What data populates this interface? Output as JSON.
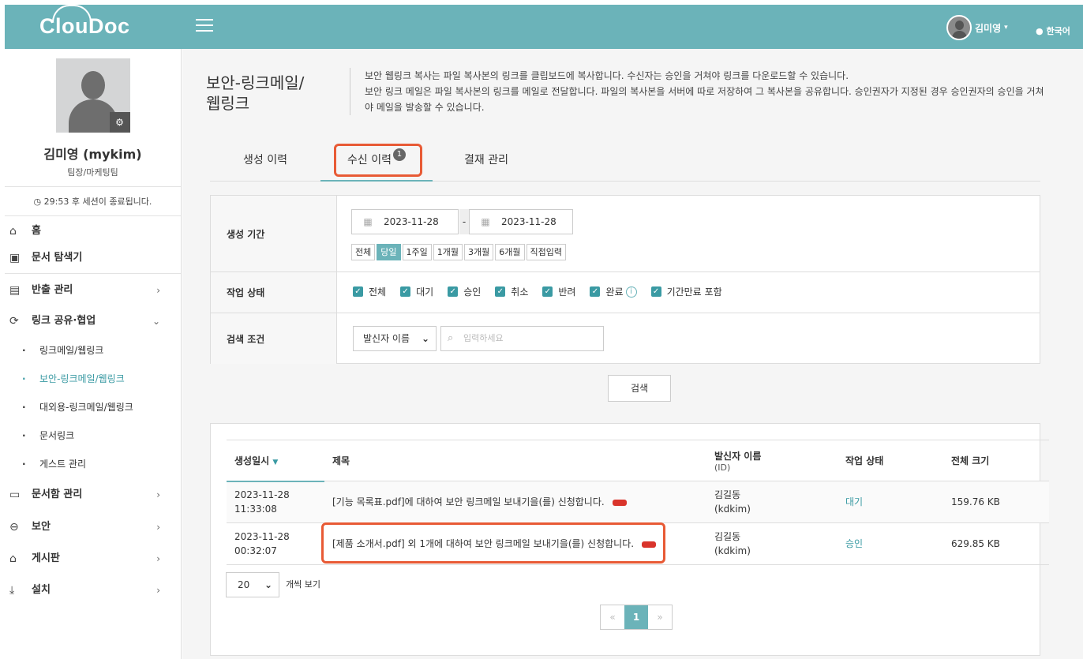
{
  "app": {
    "logo": "ClouDoc"
  },
  "header": {
    "user_name": "김미영",
    "lang": "한국어"
  },
  "profile": {
    "name": "김미영 (mykim)",
    "team": "팀장/마케팅팀",
    "session": "29:53 후 세션이 종료됩니다."
  },
  "sidebar": {
    "items": [
      {
        "label": "홈",
        "icon": "home-icon"
      },
      {
        "label": "문서 탐색기",
        "icon": "explorer-icon"
      },
      {
        "label": "반출 관리",
        "icon": "export-icon"
      },
      {
        "label": "링크 공유·협업",
        "icon": "share-icon"
      },
      {
        "label": "링크메일/웹링크"
      },
      {
        "label": "보안-링크메일/웹링크"
      },
      {
        "label": "대외용-링크메일/웹링크"
      },
      {
        "label": "문서링크"
      },
      {
        "label": "게스트 관리"
      },
      {
        "label": "문서함 관리",
        "icon": "folder-icon"
      },
      {
        "label": "보안",
        "icon": "lock-icon"
      },
      {
        "label": "게시판",
        "icon": "board-icon"
      },
      {
        "label": "설치",
        "icon": "download-icon"
      }
    ]
  },
  "page": {
    "title": "보안-링크메일/\n웹링크",
    "desc1": "보안 웹링크 복사는 파일 복사본의 링크를 클립보드에 복사합니다. 수신자는 승인을 거쳐야 링크를 다운로드할 수 있습니다.",
    "desc2": "보안 링크 메일은 파일 복사본의 링크를 메일로 전달합니다. 파일의 복사본을 서버에 따로 저장하여 그 복사본을 공유합니다. 승인권자가 지정된 경우 승인권자의 승인을 거쳐야 메일을 발송할 수 있습니다."
  },
  "tabs": [
    {
      "label": "생성 이력"
    },
    {
      "label": "수신 이력",
      "badge": "1"
    },
    {
      "label": "결재 관리"
    }
  ],
  "filter": {
    "period_label": "생성 기간",
    "date_from": "2023-11-28",
    "date_to": "2023-11-28",
    "date_sep": "-",
    "quick": [
      "전체",
      "당일",
      "1주일",
      "1개월",
      "3개월",
      "6개월",
      "직접입력"
    ],
    "status_label": "작업 상태",
    "status": [
      "전체",
      "대기",
      "승인",
      "취소",
      "반려",
      "완료",
      "기간만료 포함"
    ],
    "search_label": "검색 조건",
    "search_field": "발신자 이름",
    "search_placeholder": "입력하세요"
  },
  "search_button": "검색",
  "table": {
    "headers": {
      "date": "생성일시",
      "title": "제목",
      "sender": "발신자 이름",
      "sender_sub": "(ID)",
      "status": "작업 상태",
      "size": "전체 크기"
    },
    "rows": [
      {
        "date1": "2023-11-28",
        "date2": "11:33:08",
        "title": "[기능 목록표.pdf]에 대하여 보안 링크메일 보내기을(를) 신청합니다.",
        "sender1": "김길동",
        "sender2": "(kdkim)",
        "status": "대기",
        "size": "159.76 KB"
      },
      {
        "date1": "2023-11-28",
        "date2": "00:32:07",
        "title": "[제품 소개서.pdf] 외 1개에 대하여 보안 링크메일 보내기을(를) 신청합니다.",
        "sender1": "김길동",
        "sender2": "(kdkim)",
        "status": "승인",
        "size": "629.85 KB"
      }
    ]
  },
  "pagination": {
    "page_size": "20",
    "page_size_label": "개씩 보기",
    "prev": "«",
    "current": "1",
    "next": "»"
  },
  "colors": {
    "accent": "#6bb3b9",
    "highlight": "#e85a35",
    "tag": "#d9342b"
  }
}
